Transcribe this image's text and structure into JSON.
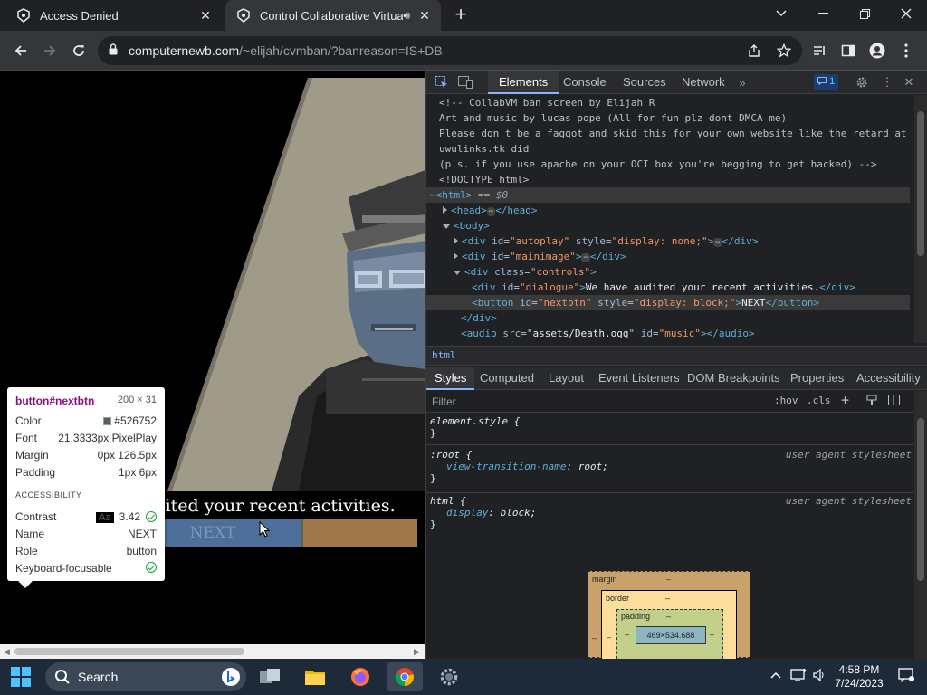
{
  "browser": {
    "tabs": [
      {
        "title": "Access Denied",
        "active": false
      },
      {
        "title": "Control Collaborative Virtual",
        "active": true
      }
    ],
    "url_host": "computernewb.com",
    "url_path": "/~elijah/cvmban/?banreason=IS+DB"
  },
  "page": {
    "dialogue": "We have audited your recent activities.",
    "next_label": "NEXT"
  },
  "tooltip": {
    "selector_tag": "button",
    "selector_id": "#nextbtn",
    "dimensions": "200 × 31",
    "rows": [
      {
        "label": "Color",
        "value": "#526752"
      },
      {
        "label": "Font",
        "value": "21.3333px PixelPlay"
      },
      {
        "label": "Margin",
        "value": "0px 126.5px"
      },
      {
        "label": "Padding",
        "value": "1px 6px"
      }
    ],
    "section": "ACCESSIBILITY",
    "a11y": [
      {
        "label": "Contrast",
        "value": "3.42"
      },
      {
        "label": "Name",
        "value": "NEXT"
      },
      {
        "label": "Role",
        "value": "button"
      },
      {
        "label": "Keyboard-focusable",
        "value": ""
      }
    ],
    "aa": "Aa",
    "swatch_color": "#526752"
  },
  "devtools": {
    "tabs": [
      "Elements",
      "Console",
      "Sources",
      "Network"
    ],
    "issues_count": "1",
    "dom": [
      "<!-- CollabVM ban screen by Elijah R",
      "Art and music by lucas pope (All for fun plz dont DMCA me)",
      "Please don't be a faggot and skid this for your own website like the retard at",
      "uwulinks.tk did",
      "(p.s. if you use apache on your OCI box you're begging to get hacked) -->",
      "<!DOCTYPE html>"
    ],
    "html_line": {
      "tag": "<html>",
      "marker": "== $0"
    },
    "head_line": {
      "open": "<head>",
      "close": "</head>"
    },
    "body_line": "<body>",
    "autoplay_line": {
      "open": "<div",
      "attr": "id",
      "val": "\"autoplay\"",
      "attr2": "style",
      "val2": "\"display: none;\"",
      "close": "</div>"
    },
    "mainimage_line": {
      "open": "<div",
      "attr": "id",
      "val": "\"mainimage\"",
      "close": "</div>"
    },
    "controls_line": {
      "open": "<div",
      "attr": "class",
      "val": "\"controls\""
    },
    "dialogue_line": {
      "open": "<div",
      "attr": "id",
      "val": "\"dialogue\"",
      "text": "We have audited your recent activities.",
      "close": "</div>"
    },
    "button_line": {
      "open": "<button",
      "attr": "id",
      "val": "\"nextbtn\"",
      "attr2": "style",
      "val2": "\"display: block;\"",
      "text": "NEXT",
      "close": "</button>"
    },
    "div_close": "</div>",
    "audio_line": {
      "open": "<audio",
      "attr": "src",
      "val": "assets/Death.ogg",
      "attr2": "id",
      "val2": "\"music\"",
      "close": "</audio>"
    },
    "breadcrumb": "html",
    "subtabs": [
      "Styles",
      "Computed",
      "Layout",
      "Event Listeners",
      "DOM Breakpoints",
      "Properties",
      "Accessibility"
    ],
    "filter_placeholder": "Filter",
    "hov": ":hov",
    "cls": ".cls",
    "rules": [
      {
        "selector": "element.style {",
        "source": "",
        "props": [],
        "close": "}"
      },
      {
        "selector": ":root {",
        "source": "user agent stylesheet",
        "props": [
          {
            "name": "view-transition-name",
            "value": "root;"
          }
        ],
        "close": "}"
      },
      {
        "selector": "html {",
        "source": "user agent stylesheet",
        "props": [
          {
            "name": "display",
            "value": "block;"
          }
        ],
        "close": "}"
      }
    ],
    "boxmodel": {
      "margin": "margin",
      "border": "border",
      "padding": "padding",
      "content": "469×534.688",
      "dash": "–"
    }
  },
  "taskbar": {
    "search": "Search",
    "time": "4:58 PM",
    "date": "7/24/2023"
  }
}
